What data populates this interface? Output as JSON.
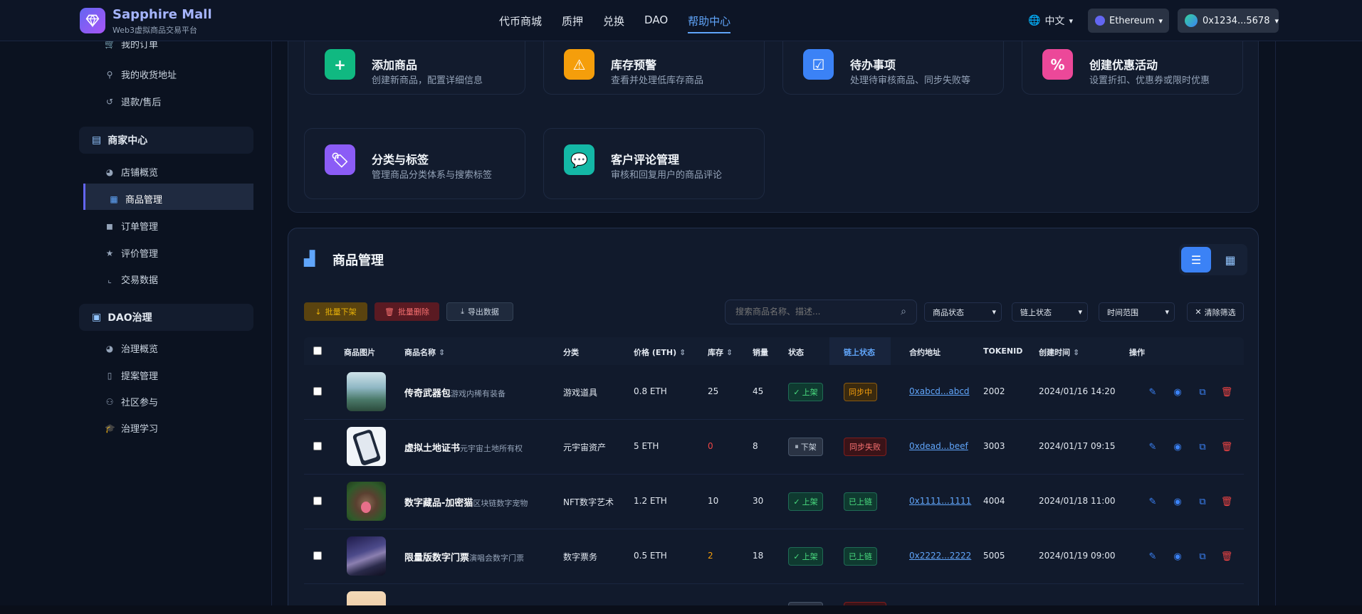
{
  "header": {
    "brand_name": "Sapphire Mall",
    "brand_sub": "Web3虚拟商品交易平台",
    "nav": [
      "代币商城",
      "质押",
      "兑换",
      "DAO",
      "帮助中心"
    ],
    "nav_active_index": 4,
    "language": "中文",
    "chain": "Ethereum",
    "wallet": "0x1234...5678"
  },
  "sidebar": {
    "user_items": [
      {
        "label": "我的订单",
        "icon": "cart-icon"
      },
      {
        "label": "我的收货地址",
        "icon": "map-pin-icon"
      },
      {
        "label": "退款/售后",
        "icon": "undo-icon"
      }
    ],
    "merchant_section": "商家中心",
    "merchant_items": [
      {
        "label": "店铺概览",
        "icon": "pie-chart-icon"
      },
      {
        "label": "商品管理",
        "icon": "box-icon",
        "active": true
      },
      {
        "label": "订单管理",
        "icon": "bag-icon"
      },
      {
        "label": "评价管理",
        "icon": "star-icon"
      },
      {
        "label": "交易数据",
        "icon": "line-chart-icon"
      }
    ],
    "dao_section": "DAO治理",
    "dao_items": [
      {
        "label": "治理概览",
        "icon": "pie-chart-icon"
      },
      {
        "label": "提案管理",
        "icon": "clipboard-icon"
      },
      {
        "label": "社区参与",
        "icon": "users-icon"
      },
      {
        "label": "治理学习",
        "icon": "graduation-cap-icon"
      }
    ]
  },
  "quick_actions": [
    {
      "title": "添加商品",
      "desc": "创建新商品，配置详细信息",
      "icon": "plus-icon",
      "color": "#10b981"
    },
    {
      "title": "库存预警",
      "desc": "查看并处理低库存商品",
      "icon": "warning-icon",
      "color": "#f59e0b"
    },
    {
      "title": "待办事项",
      "desc": "处理待审核商品、同步失败等",
      "icon": "clipboard-check-icon",
      "color": "#3b82f6"
    },
    {
      "title": "创建优惠活动",
      "desc": "设置折扣、优惠券或限时优惠",
      "icon": "percent-icon",
      "color": "#ec4899"
    },
    {
      "title": "分类与标签",
      "desc": "管理商品分类体系与搜索标签",
      "icon": "tags-icon",
      "color": "#8b5cf6"
    },
    {
      "title": "客户评论管理",
      "desc": "审核和回复用户的商品评论",
      "icon": "comments-icon",
      "color": "#14b8a6"
    }
  ],
  "product_panel": {
    "title": "商品管理",
    "bulk_offline": "批量下架",
    "bulk_delete": "批量删除",
    "export": "导出数据",
    "search_placeholder": "搜索商品名称、描述...",
    "filters": [
      "商品状态",
      "链上状态",
      "时间范围"
    ],
    "clear_filter": "清除筛选",
    "columns": [
      "商品图片",
      "商品名称",
      "分类",
      "价格 (ETH)",
      "库存",
      "销量",
      "状态",
      "链上状态",
      "合约地址",
      "TOKENID",
      "创建时间",
      "操作"
    ],
    "rows": [
      {
        "name": "传奇武器包",
        "sub": "游戏内稀有装备",
        "category": "游戏道具",
        "price": "0.8 ETH",
        "stock": "25",
        "sales": "45",
        "status": "上架",
        "chain_status": "同步中",
        "contract": "0xabcd...abcd",
        "token_id": "2002",
        "created": "2024/01/16 14:20"
      },
      {
        "name": "虚拟土地证书",
        "sub": "元宇宙土地所有权",
        "category": "元宇宙资产",
        "price": "5 ETH",
        "stock": "0",
        "sales": "8",
        "status": "下架",
        "chain_status": "同步失败",
        "contract": "0xdead...beef",
        "token_id": "3003",
        "created": "2024/01/17 09:15"
      },
      {
        "name": "数字藏品-加密猫",
        "sub": "区块链数字宠物",
        "category": "NFT数字艺术",
        "price": "1.2 ETH",
        "stock": "10",
        "sales": "30",
        "status": "上架",
        "chain_status": "已上链",
        "contract": "0x1111...1111",
        "token_id": "4004",
        "created": "2024/01/18 11:00"
      },
      {
        "name": "限量版数字门票",
        "sub": "演唱会数字门票",
        "category": "数字票务",
        "price": "0.5 ETH",
        "stock": "2",
        "sales": "18",
        "status": "上架",
        "chain_status": "已上链",
        "contract": "0x2222...2222",
        "token_id": "5005",
        "created": "2024/01/19 09:00"
      }
    ]
  }
}
